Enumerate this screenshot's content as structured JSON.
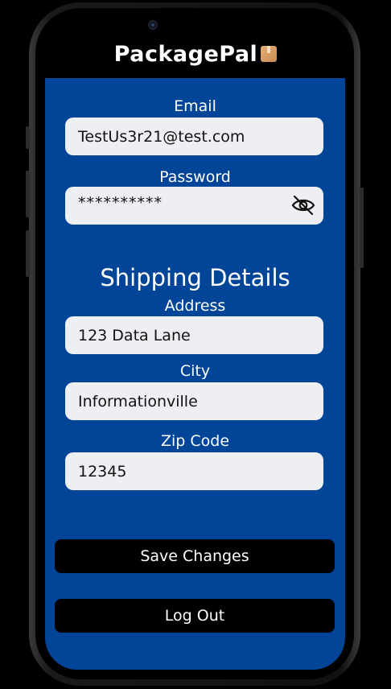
{
  "app": {
    "logo_text": "PackagePal",
    "logo_icon": "package-box-icon"
  },
  "account": {
    "email_label": "Email",
    "email_value": "TestUs3r21@test.com",
    "password_label": "Password",
    "password_value": "**********",
    "password_toggle_icon": "eye-slash-icon"
  },
  "shipping": {
    "title": "Shipping Details",
    "address_label": "Address",
    "address_value": "123 Data Lane",
    "city_label": "City",
    "city_value": "Informationville",
    "zip_label": "Zip Code",
    "zip_value": "12345"
  },
  "actions": {
    "save_label": "Save Changes",
    "logout_label": "Log Out"
  },
  "colors": {
    "screen_bg": "#004597",
    "field_bg": "#eeeff3",
    "button_bg": "#000000",
    "text_light": "#ffffff"
  }
}
